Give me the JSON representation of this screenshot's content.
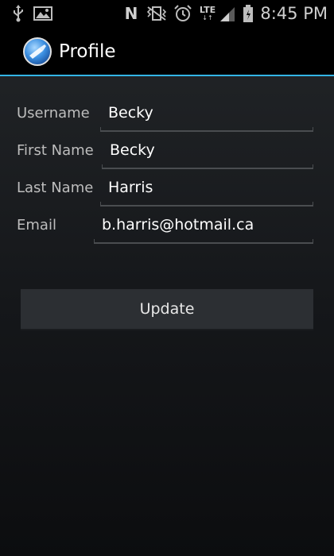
{
  "status_bar": {
    "time": "8:45 PM",
    "icons": [
      "usb-icon",
      "image-icon",
      "nfc-icon",
      "vibrate-icon",
      "alarm-icon",
      "lte-icon",
      "signal-icon",
      "battery-icon"
    ],
    "lte_label": "LTE",
    "nfc_label": "N"
  },
  "action_bar": {
    "title": "Profile"
  },
  "form": {
    "fields": [
      {
        "label": "Username",
        "value": "Becky"
      },
      {
        "label": "First Name",
        "value": "Becky"
      },
      {
        "label": "Last Name",
        "value": "Harris"
      },
      {
        "label": "Email",
        "value": "b.harris@hotmail.ca"
      }
    ]
  },
  "update_button": {
    "label": "Update"
  },
  "colors": {
    "accent": "#33b5e5",
    "background": "#1a1c1f",
    "status_bar": "#000000"
  }
}
